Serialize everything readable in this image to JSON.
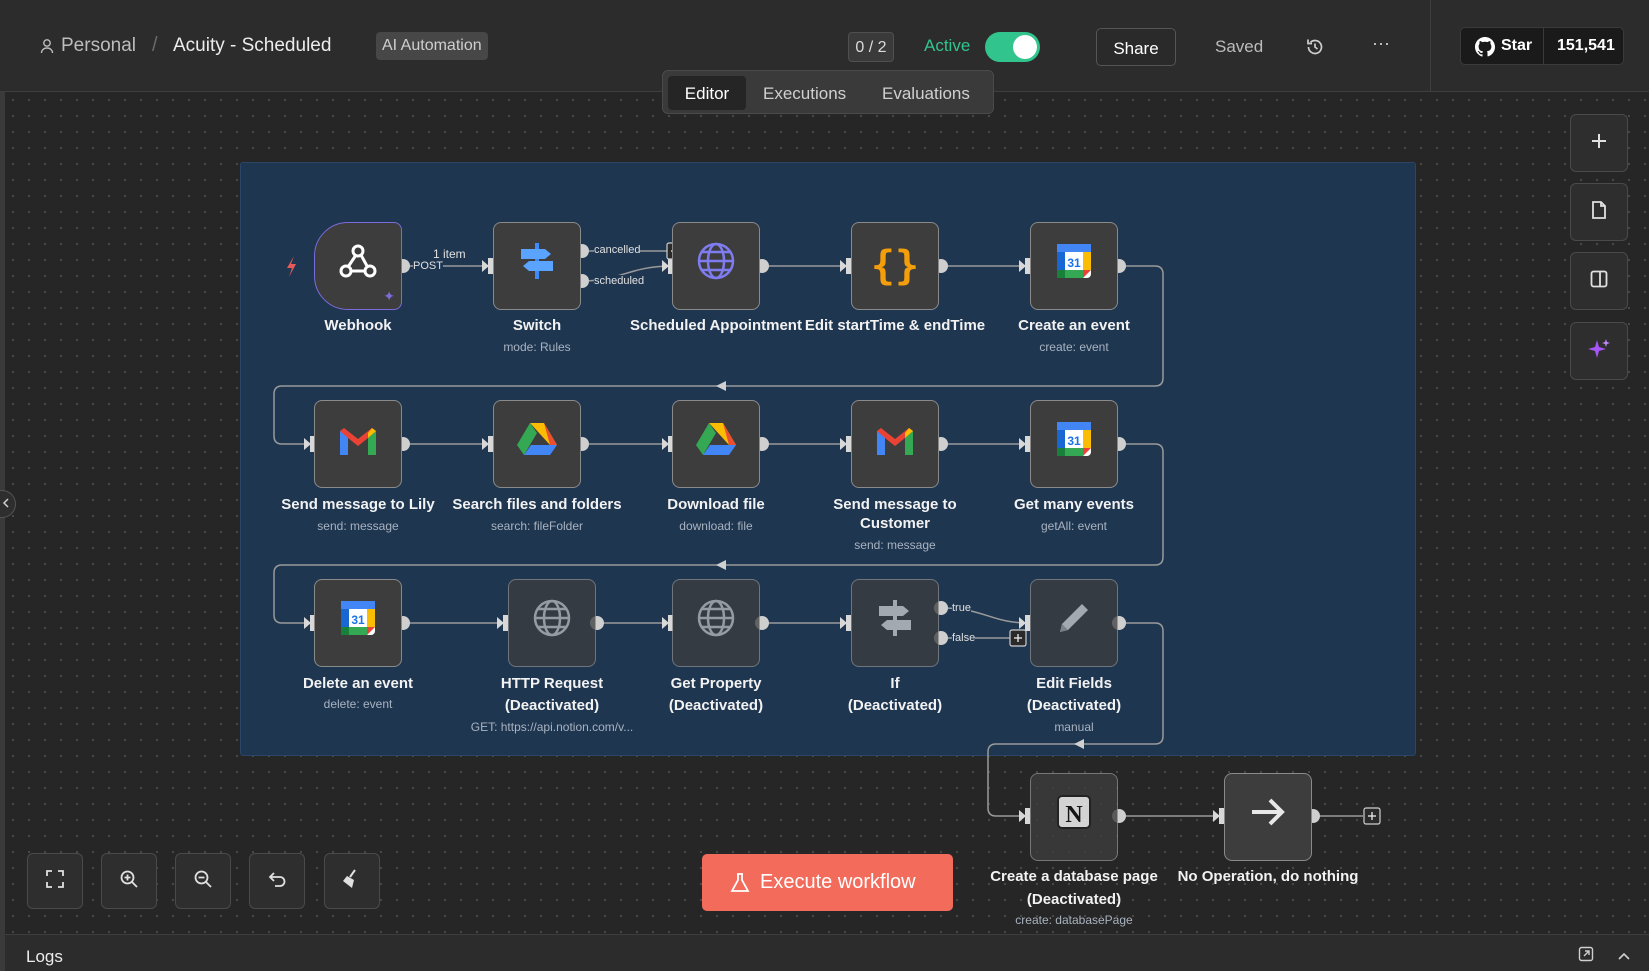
{
  "header": {
    "breadcrumb_owner": "Personal",
    "separator": "/",
    "workflow_name": "Acuity - Scheduled",
    "tag": "AI Automation",
    "counter": "0 / 2",
    "active_label": "Active",
    "active": true,
    "share": "Share",
    "saved": "Saved",
    "more": "···",
    "github_star": "Star",
    "github_count": "151,541"
  },
  "tabs": {
    "editor": "Editor",
    "executions": "Executions",
    "evaluations": "Evaluations"
  },
  "nodes": [
    {
      "name": "Webhook",
      "sub": "",
      "icon": "webhook-icon"
    },
    {
      "name": "Switch",
      "sub": "mode: Rules",
      "icon": "switch-icon"
    },
    {
      "name": "Scheduled Appointment",
      "sub": "",
      "icon": "globe-icon"
    },
    {
      "name": "Edit startTime & endTime",
      "sub": "",
      "icon": "code-braces-icon"
    },
    {
      "name": "Create an event",
      "sub": "create: event",
      "icon": "google-calendar-icon"
    },
    {
      "name": "Send message to Lily",
      "sub": "send: message",
      "icon": "gmail-icon"
    },
    {
      "name": "Search files and folders",
      "sub": "search: fileFolder",
      "icon": "google-drive-icon"
    },
    {
      "name": "Download file",
      "sub": "download: file",
      "icon": "google-drive-icon"
    },
    {
      "name": "Send message to",
      "name2": "Customer",
      "sub": "send: message",
      "icon": "gmail-icon"
    },
    {
      "name": "Get many events",
      "sub": "getAll: event",
      "icon": "google-calendar-icon"
    },
    {
      "name": "Delete an event",
      "sub": "delete: event",
      "icon": "google-calendar-icon"
    },
    {
      "name": "HTTP Request",
      "name2": "(Deactivated)",
      "sub": "GET: https://api.notion.com/v...",
      "icon": "globe-icon"
    },
    {
      "name": "Get Property",
      "name2": "(Deactivated)",
      "sub": "",
      "icon": "globe-icon"
    },
    {
      "name": "If",
      "name2": "(Deactivated)",
      "sub": "",
      "icon": "if-signpost-icon"
    },
    {
      "name": "Edit Fields",
      "name2": "(Deactivated)",
      "sub": "manual",
      "icon": "pencil-icon"
    },
    {
      "name": "Create a database page",
      "name2": "(Deactivated)",
      "sub": "create: databasePage",
      "icon": "notion-icon"
    },
    {
      "name": "No Operation, do nothing",
      "sub": "",
      "icon": "arrow-right-icon"
    }
  ],
  "connection_labels": {
    "items": "1 item",
    "post": "POST",
    "cancelled": "cancelled",
    "scheduled": "scheduled",
    "true": "true",
    "false": "false"
  },
  "calendar_day": "31",
  "toolbar": {
    "execute": "Execute workflow"
  },
  "logs": {
    "title": "Logs"
  },
  "colors": {
    "accent_green": "#31c48d",
    "execute": "#f26b5b",
    "sticky": "#1f3651",
    "trigger_border": "#7c6bd8"
  }
}
